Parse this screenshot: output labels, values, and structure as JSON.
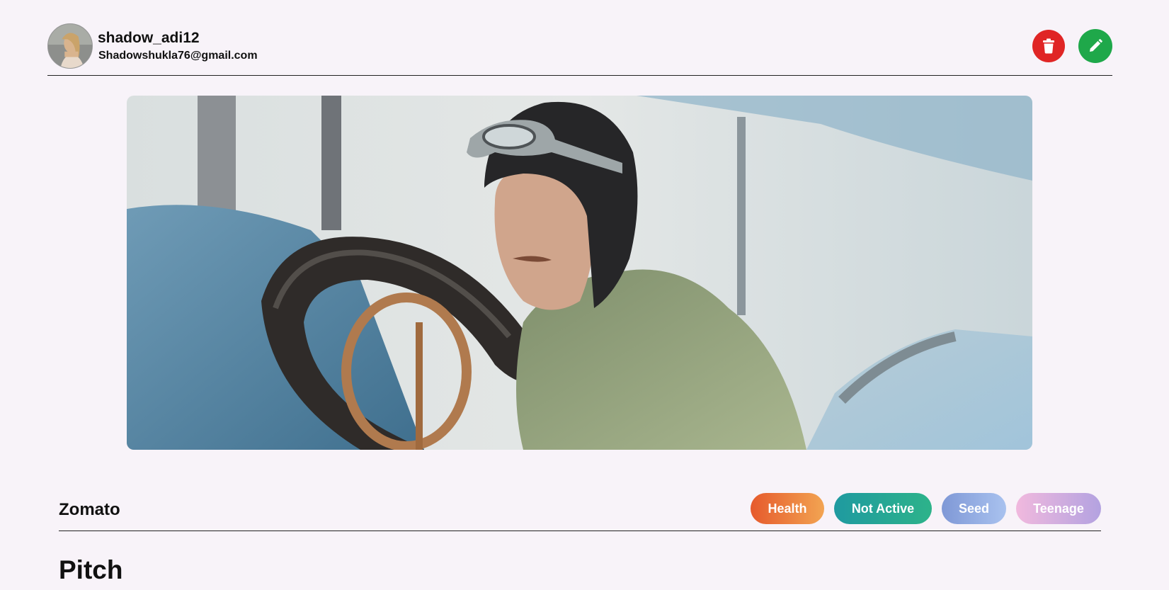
{
  "profile": {
    "username": "shadow_adi12",
    "email": "Shadowshukla76@gmail.com"
  },
  "actions": {
    "delete_icon": "trash-icon",
    "edit_icon": "pencil-icon",
    "delete_color": "#e02525",
    "edit_color": "#1fa84a"
  },
  "startup": {
    "name": "Zomato",
    "tags": {
      "category": "Health",
      "status": "Not Active",
      "stage": "Seed",
      "age": "Teenage"
    }
  },
  "section": {
    "heading": "Pitch"
  }
}
